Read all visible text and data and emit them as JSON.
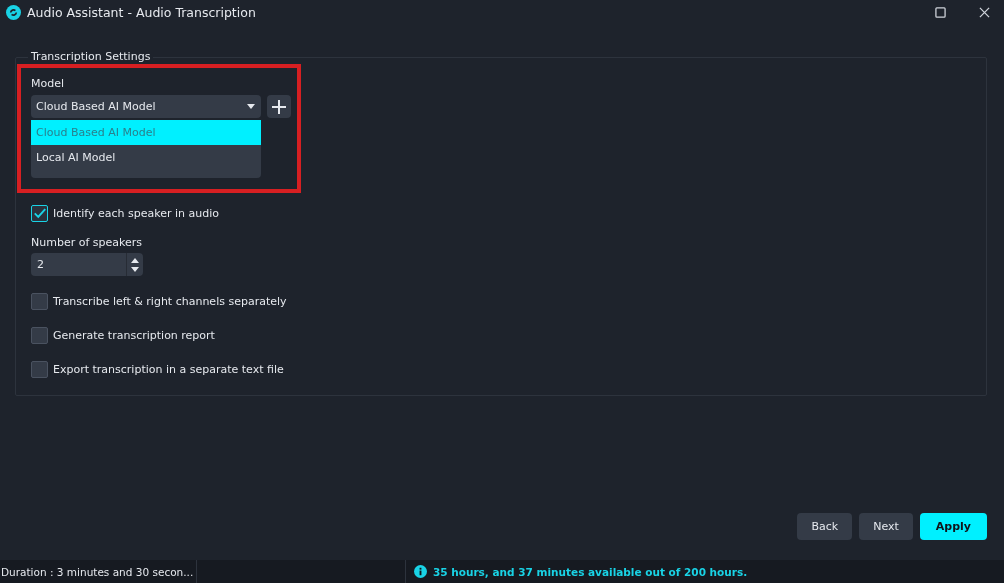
{
  "window": {
    "title": "Audio Assistant - Audio Transcription"
  },
  "settings": {
    "title": "Transcription Settings",
    "model": {
      "label": "Model",
      "value": "Cloud Based AI Model",
      "expanded": true,
      "options": [
        {
          "label": "Cloud Based AI Model",
          "selected": true
        },
        {
          "label": "Local AI Model",
          "selected": false
        }
      ]
    },
    "highlight": true,
    "items": [
      {
        "kind": "checkbox",
        "label": "Identify each speaker in audio",
        "checked": true
      },
      {
        "kind": "spinbox",
        "label": "Number of speakers",
        "value": "2"
      },
      {
        "kind": "checkbox",
        "label": "Transcribe left & right channels separately",
        "checked": false
      },
      {
        "kind": "checkbox",
        "label": "Generate transcription report",
        "checked": false
      },
      {
        "kind": "checkbox",
        "label": "Export transcription in a separate text file",
        "checked": false
      }
    ]
  },
  "buttons": [
    {
      "label": "Back",
      "primary": false
    },
    {
      "label": "Next",
      "primary": false
    },
    {
      "label": "Apply",
      "primary": true
    }
  ],
  "status_bar": {
    "duration": "Duration : 3 minutes and 30 secon...",
    "availability": "35 hours, and 37 minutes available out of 200 hours."
  }
}
